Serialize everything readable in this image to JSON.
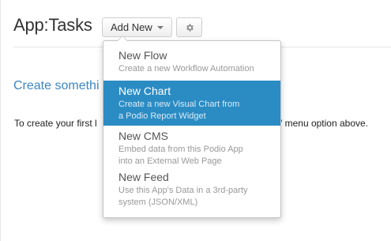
{
  "header": {
    "title": "App:Tasks",
    "add_new_label": "Add New",
    "settings_icon": "gear-icon"
  },
  "content": {
    "section_heading": "Create somethi",
    "instructions_start": "To create your first l",
    "instructions_end": "\" menu option above."
  },
  "dropdown": {
    "items": [
      {
        "title": "New Flow",
        "desc_line1": "Create a new Workflow Automation",
        "desc_line2": ""
      },
      {
        "title": "New Chart",
        "desc_line1": "Create a new Visual Chart from",
        "desc_line2": "a Podio Report Widget"
      },
      {
        "title": "New CMS",
        "desc_line1": "Embed data from this Podio App",
        "desc_line2": "into an External Web Page"
      },
      {
        "title": "New Feed",
        "desc_line1": "Use this App's Data in a 3rd-party",
        "desc_line2": "system (JSON/XML)"
      }
    ]
  },
  "colors": {
    "accent": "#2b8cc4",
    "heading_link": "#3e86c2"
  }
}
